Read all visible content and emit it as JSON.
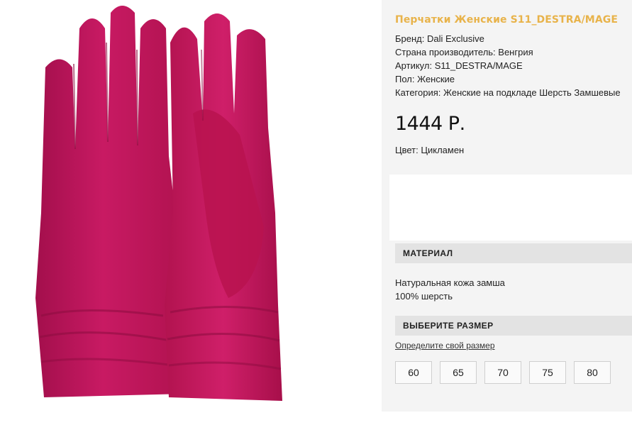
{
  "product": {
    "title": "Перчатки Женские S11_DESTRA/MAGE",
    "specs": [
      "Бренд: Dali Exclusive",
      "Страна производитель: Венгрия",
      "Артикул: S11_DESTRA/MAGE",
      "Пол: Женские",
      "Категория: Женские на подкладе Шерсть Замшевые"
    ],
    "price": "1444 Р.",
    "color_line": "Цвет: Цикламен",
    "image_color": "#c4155e"
  },
  "material": {
    "heading": "МАТЕРИАЛ",
    "lines": [
      "Натуральная кожа замша",
      "100% шерсть"
    ]
  },
  "size_section": {
    "heading": "ВЫБЕРИТЕ РАЗМЕР",
    "link": "Определите свой размер",
    "sizes": [
      "60",
      "65",
      "70",
      "75",
      "80"
    ]
  }
}
